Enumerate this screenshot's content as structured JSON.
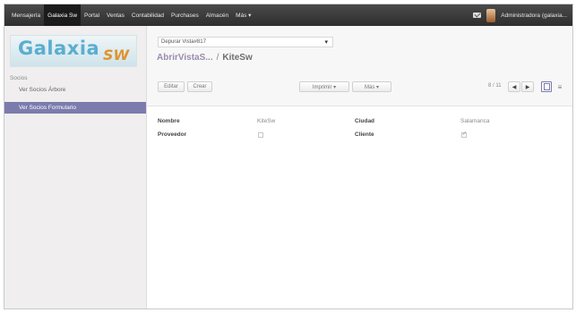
{
  "topbar": {
    "menu": [
      "Mensajería",
      "Galaxia Sw",
      "Portal",
      "Ventas",
      "Contabilidad",
      "Purchases",
      "Almacén",
      "Más ▾"
    ],
    "user": "Administradora (galaxia..."
  },
  "sidebar": {
    "logo_main": "Galaxia",
    "logo_sub": "SW",
    "section": "Socios",
    "items": [
      "Ver Socios Árbore",
      "Ver Socios Formulario"
    ]
  },
  "main": {
    "debug_select": "Depurar Vista#817",
    "breadcrumb": {
      "link": "AbrirVistaS...",
      "separator": "/",
      "current": "KiteSw"
    },
    "buttons": {
      "edit": "Editar",
      "create": "Crear",
      "print": "Imprimir ▾",
      "more": "Más ▾"
    },
    "pager": "8 / 11",
    "nav": {
      "prev": "◀",
      "next": "▶",
      "list": "≡"
    }
  },
  "form": {
    "nombre_label": "Nombre",
    "nombre_value": "KiteSw",
    "ciudad_label": "Ciudad",
    "ciudad_value": "Salamanca",
    "proveedor_label": "Proveedor",
    "proveedor_checked": false,
    "cliente_label": "Cliente",
    "cliente_checked": true
  }
}
